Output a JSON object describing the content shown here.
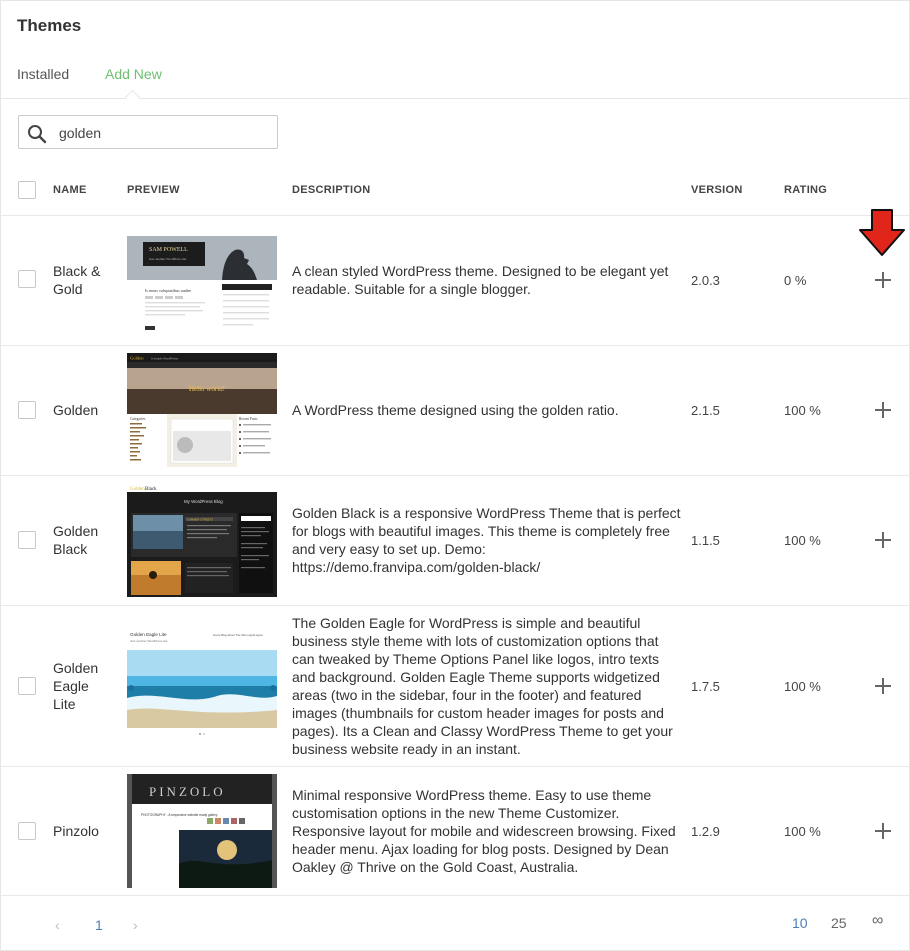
{
  "page": {
    "title": "Themes"
  },
  "tabs": [
    {
      "label": "Installed",
      "active": false
    },
    {
      "label": "Add New",
      "active": true
    }
  ],
  "search": {
    "value": "golden"
  },
  "columns": {
    "name": "NAME",
    "preview": "PREVIEW",
    "description": "DESCRIPTION",
    "version": "VERSION",
    "rating": "RATING"
  },
  "themes": [
    {
      "name": "Black & Gold",
      "description": "A clean styled WordPress theme. Designed to be elegant yet readable. Suitable for a single blogger.",
      "version": "2.0.3",
      "rating": "0 %",
      "preview": {
        "header_name": "SAM POWELL",
        "header_sub": "Just another WordPress site",
        "heading": "Is meus voluptatibus audire"
      }
    },
    {
      "name": "Golden",
      "description": "A WordPress theme designed using the golden ratio.",
      "version": "2.1.5",
      "rating": "100 %",
      "preview": {
        "brand": "Golden",
        "tagline": "A simple WordPress",
        "hero": "Hello world!",
        "side_title": "Categories",
        "recent": "Recent Posts"
      }
    },
    {
      "name": "Golden Black",
      "description": "Golden Black is a responsive WordPress Theme that is perfect for blogs with beautiful images. This theme is completely free and very easy to set up. Demo: https://demo.franvipa.com/golden-black/",
      "version": "1.1.5",
      "rating": "100 %",
      "preview": {
        "brand": "Golden",
        "brand2": "Black",
        "blog_title": "My WordPress Blog",
        "badge": "SUMMER STREETS"
      }
    },
    {
      "name": "Golden Eagle Lite",
      "description": "The Golden Eagle for WordPress is simple and beautiful business style theme with lots of customization options that can tweaked by Theme Options Panel like logos, intro texts and background. Golden Eagle Theme supports widgetized areas (two in the sidebar, four in the footer) and featured images (thumbnails for custom header images for posts and pages). Its a Clean and Classy WordPress Theme to get your business website ready in an instant.",
      "version": "1.7.5",
      "rating": "100 %",
      "preview": {
        "brand": "Golden Eagle Lite",
        "tagline": "Just another WordPress site",
        "menu": "Home  Blog  About The Site  Login/Logout"
      }
    },
    {
      "name": "Pinzolo",
      "description": "Minimal responsive WordPress theme. Easy to use theme customisation options in the new Theme Customizer. Responsive layout for mobile and widescreen browsing. Fixed header menu. Ajax loading for blog posts. Designed by Dean Oakley @ Thrive on the Gold Coast, Australia.",
      "version": "1.2.9",
      "rating": "100 %",
      "preview": {
        "brand": "PINZOLO",
        "post": "PHOTOGRAPHY - A responsive website ready gallery"
      }
    }
  ],
  "pagination": {
    "prev": "‹",
    "current": "1",
    "next": "›"
  },
  "per_page": [
    "10",
    "25",
    "∞"
  ],
  "colors": {
    "accent": "#6cc070",
    "link": "#4a7fb5",
    "arrow": "#e0261b"
  }
}
